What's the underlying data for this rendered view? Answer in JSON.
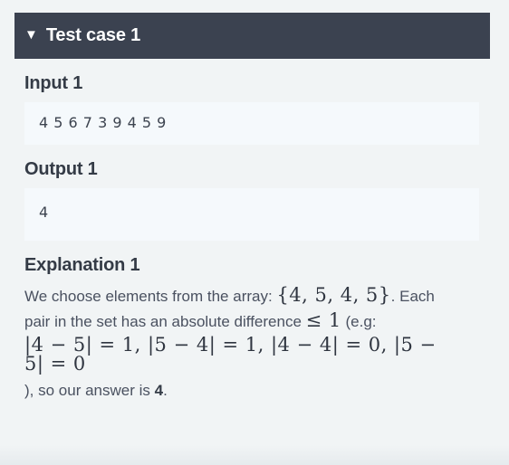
{
  "card": {
    "header": {
      "toggle_icon": "▼",
      "title": "Test case 1"
    },
    "input": {
      "heading": "Input 1",
      "value": "4  5  6  7  3  9  4  5  9"
    },
    "output": {
      "heading": "Output 1",
      "value": "4"
    },
    "explanation": {
      "heading": "Explanation 1",
      "text_before_set": "We choose elements from the array:",
      "set_math": "{4, 5, 4, 5}",
      "text_after_set": ". Each pair in the set has an absolute difference",
      "bound_math": "≤ 1",
      "text_eg_open": "(e.g:",
      "pairs_math": "|4 − 5| = 1, |5 − 4| = 1, |4 − 4| = 0, |5 − 5| = 0",
      "text_close": "), so our answer is ",
      "answer": "4",
      "period": "."
    }
  },
  "colors": {
    "page_background": "#f1f4f5",
    "header_background": "#3b4250",
    "header_text": "#ffffff",
    "io_box_background": "#f5f9fc",
    "heading_text": "#343b46",
    "body_text": "#4a5160",
    "math_text": "#2f3540"
  }
}
